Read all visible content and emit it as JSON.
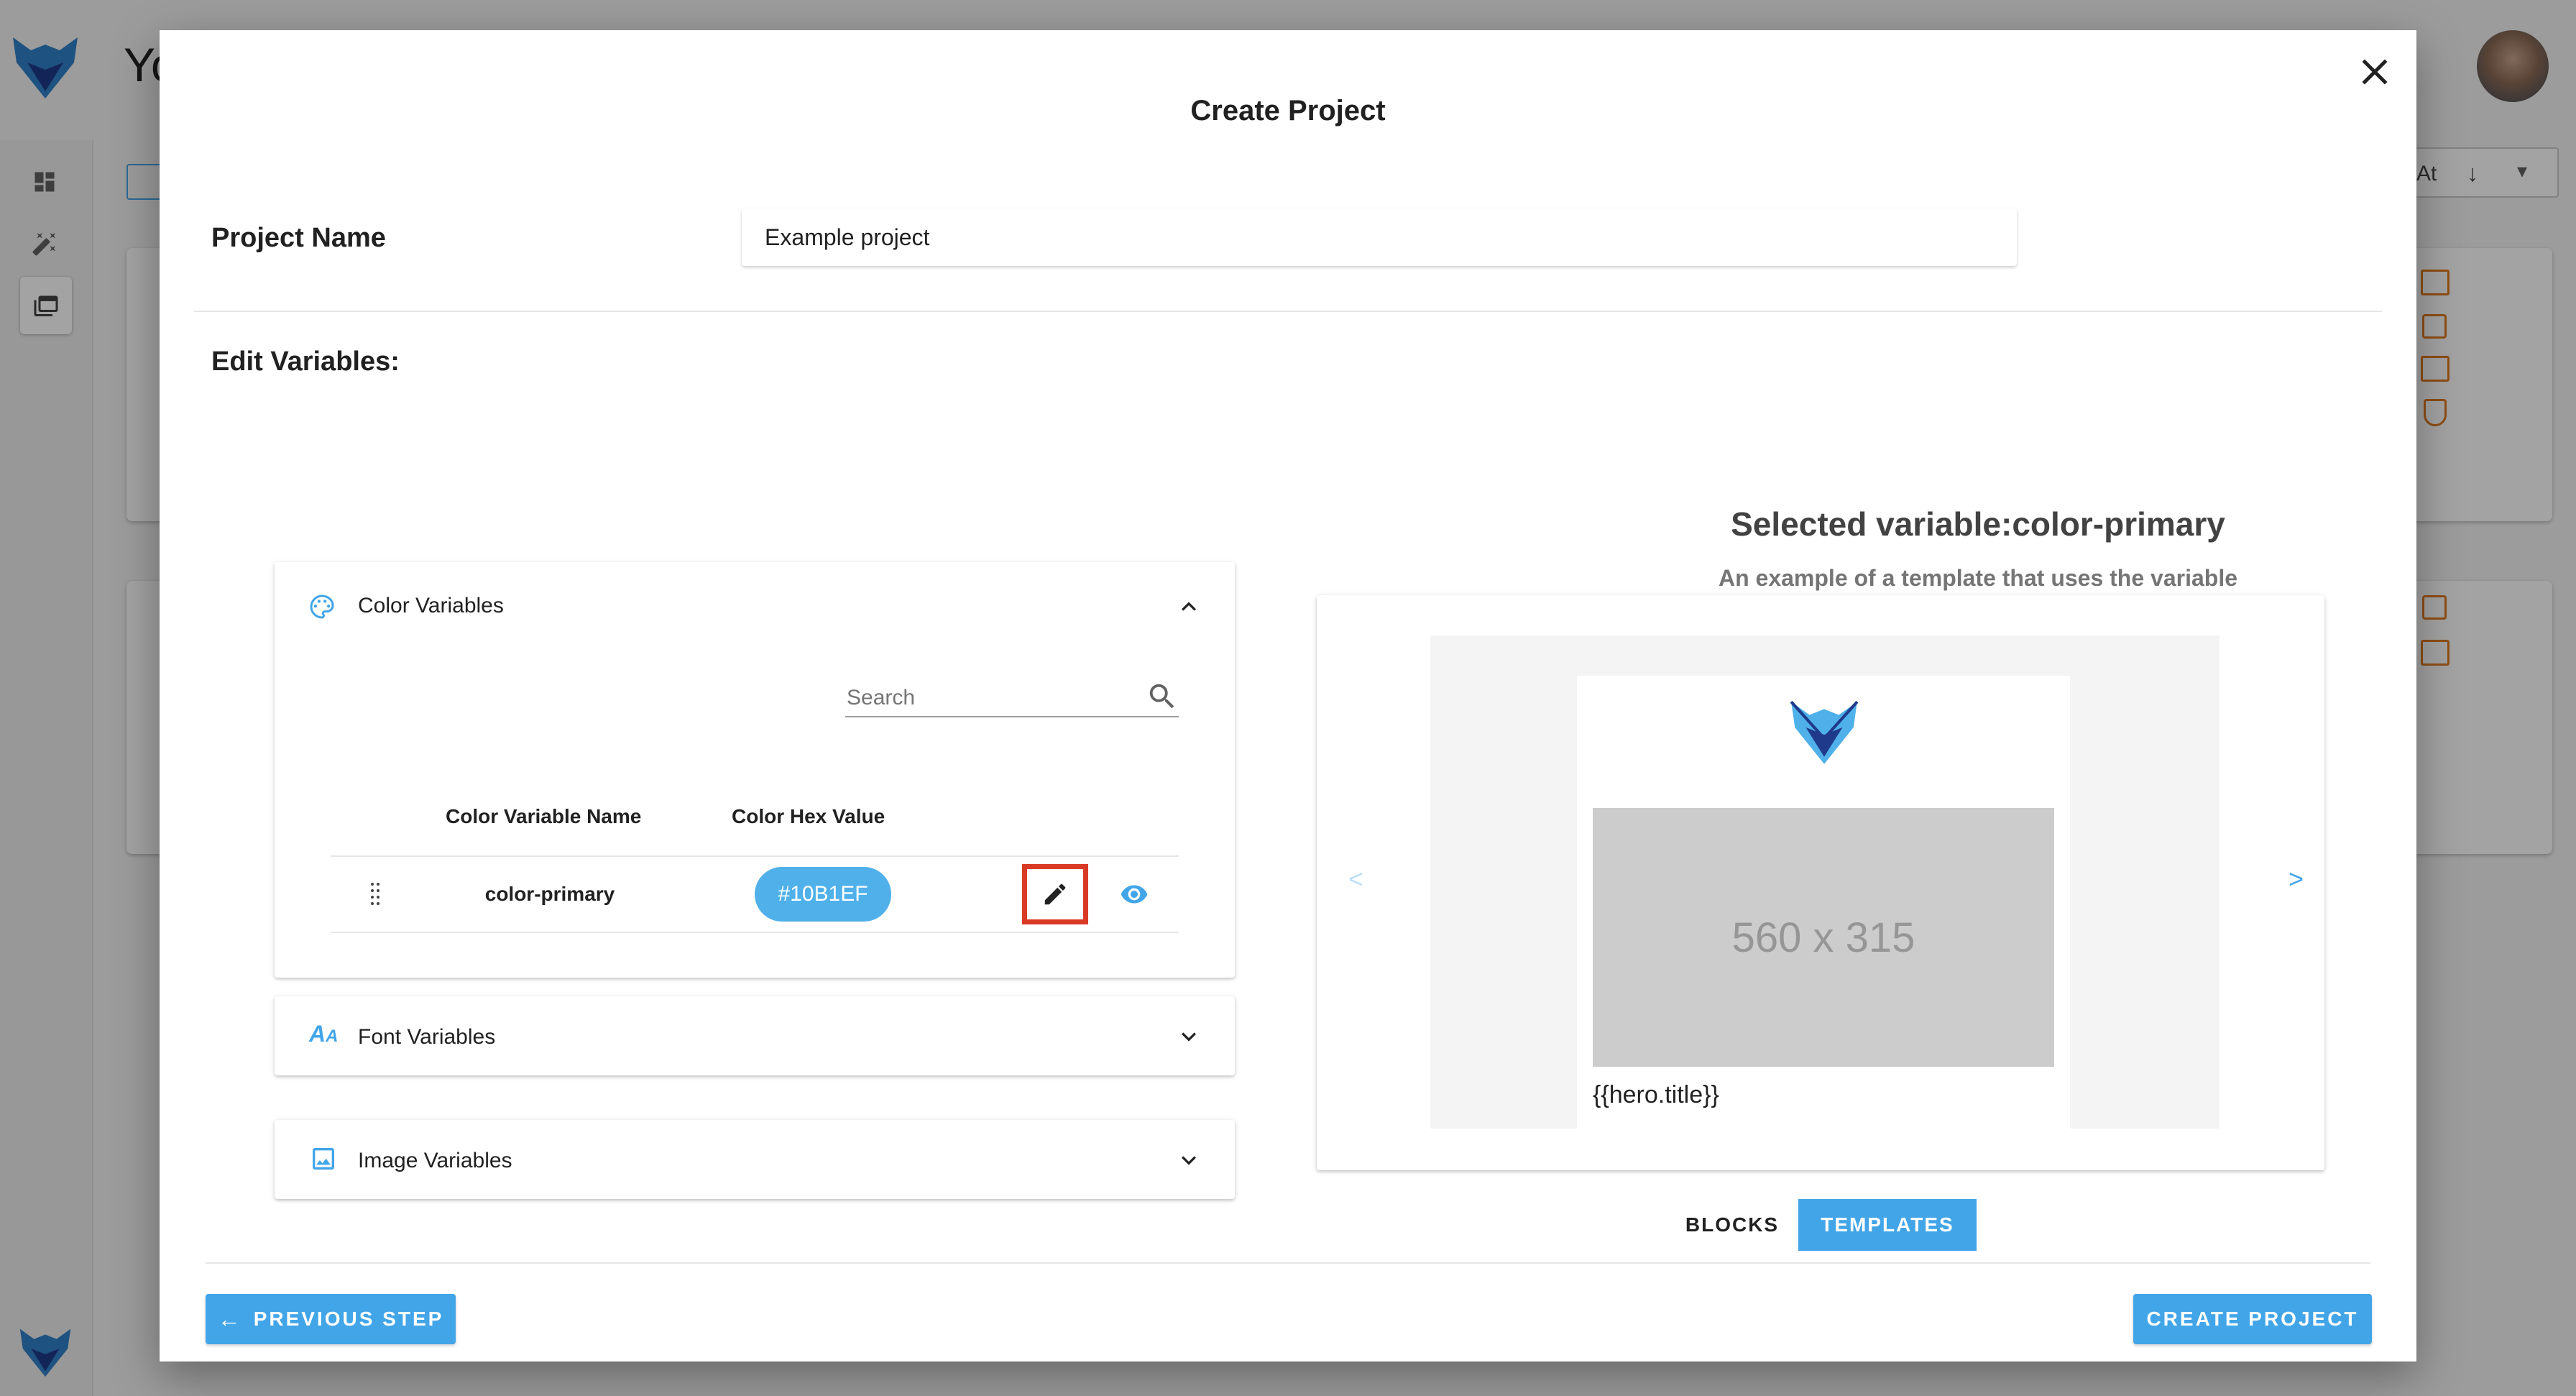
{
  "background": {
    "header_title_fragment": "Yo",
    "sort_fragment": "At"
  },
  "modal": {
    "title": "Create Project",
    "project_name_label": "Project Name",
    "project_name_value": "Example project",
    "edit_variables_label": "Edit Variables:",
    "color_section": {
      "title": "Color Variables",
      "search_placeholder": "Search",
      "columns": [
        "Color Variable Name",
        "Color Hex Value"
      ],
      "rows": [
        {
          "name": "color-primary",
          "hex": "#10B1EF"
        }
      ]
    },
    "font_section": {
      "title": "Font Variables"
    },
    "image_section": {
      "title": "Image Variables"
    },
    "preview": {
      "heading": "Selected variable:color-primary",
      "subheading": "An example of a template that uses the variable",
      "placeholder_size": "560 x 315",
      "hero_title": "{{hero.title}}",
      "prev_arrow": "<",
      "next_arrow": ">",
      "tabs": [
        "BLOCKS",
        "TEMPLATES"
      ],
      "active_tab": "TEMPLATES"
    },
    "buttons": {
      "previous": "PREVIOUS STEP",
      "create": "CREATE PROJECT"
    }
  },
  "colors": {
    "accent": "#42a5e8",
    "chip": "#4fb0ea",
    "highlight": "#d93a25",
    "logo_dark": "#1f3a8a",
    "logo_light": "#2f80c8"
  }
}
